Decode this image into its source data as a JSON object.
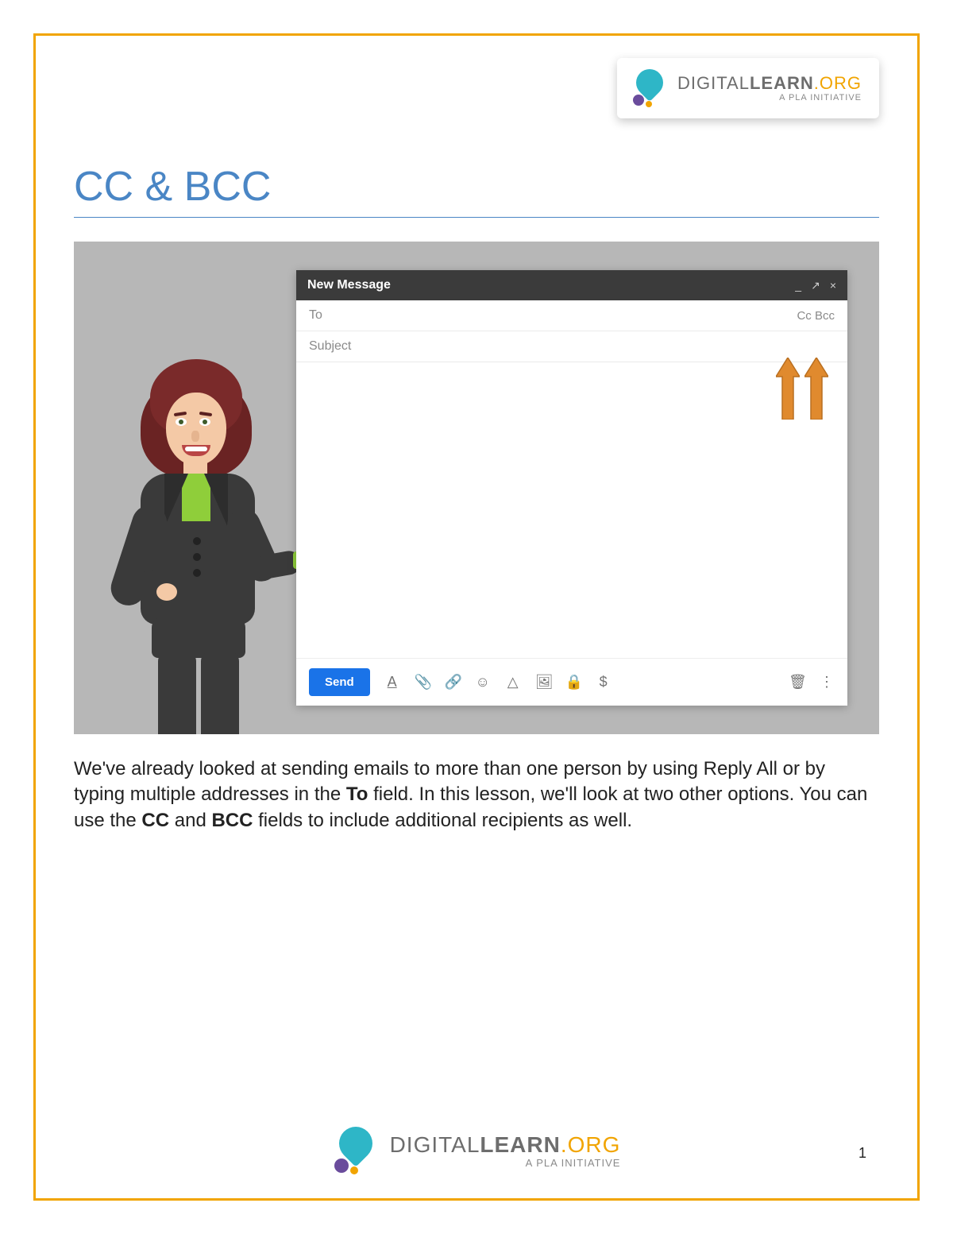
{
  "logo": {
    "text_digital": "DIGITAL",
    "text_learn": "LEARN",
    "text_org": ".ORG",
    "tagline": "A PLA INITIATIVE"
  },
  "heading": "CC & BCC",
  "compose": {
    "title": "New Message",
    "minimize": "_",
    "expand": "↗",
    "close": "×",
    "to_label": "To",
    "cc_label": "Cc",
    "bcc_label": "Bcc",
    "subject_label": "Subject",
    "send_label": "Send",
    "icons": {
      "format": "A",
      "attach": "📎",
      "link": "🔗",
      "emoji": "☺",
      "drive": "△",
      "photo": "🖼",
      "lock": "🔒",
      "money": "$",
      "trash": "🗑",
      "more": "⋮"
    }
  },
  "paragraph": {
    "p1": "We've already looked at sending emails to more than one person by using Reply All or by typing multiple addresses in the ",
    "b1": "To",
    "p2": " field. In this lesson, we'll look at two other options. You can use the ",
    "b2": "CC",
    "p3": " and ",
    "b3": "BCC",
    "p4": " fields to include additional recipients as well."
  },
  "page_number": "1"
}
